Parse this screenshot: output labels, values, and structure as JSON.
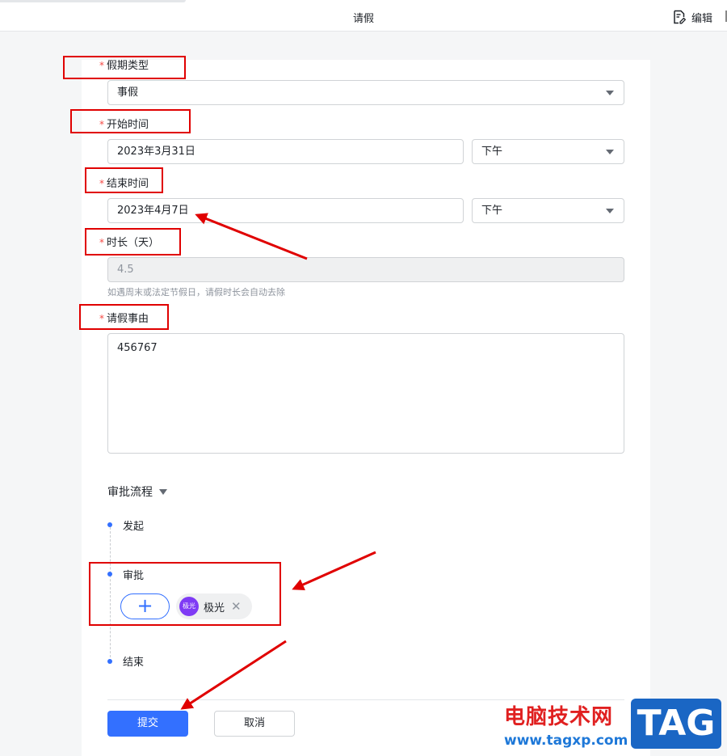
{
  "header": {
    "title": "请假",
    "edit_label": "编辑"
  },
  "form": {
    "leave_type": {
      "label": "假期类型",
      "value": "事假"
    },
    "start_time": {
      "label": "开始时间",
      "date": "2023年3月31日",
      "period": "下午"
    },
    "end_time": {
      "label": "结束时间",
      "date": "2023年4月7日",
      "period": "下午"
    },
    "duration": {
      "label": "时长（天）",
      "value": "4.5",
      "hint": "如遇周末或法定节假日，请假时长会自动去除"
    },
    "reason": {
      "label": "请假事由",
      "value": "456767"
    },
    "required_mark": "*"
  },
  "approval": {
    "title": "审批流程",
    "steps": [
      {
        "label": "发起"
      },
      {
        "label": "审批"
      },
      {
        "label": "结束"
      }
    ],
    "add_symbol": "+",
    "approver": {
      "name": "极光",
      "avatar_text": "极光",
      "remove_symbol": "✕"
    }
  },
  "actions": {
    "submit_label": "提交",
    "cancel_label": "取消"
  },
  "watermark": {
    "site_name": "电脑技术网",
    "url": "www.tagxp.com",
    "tag": "TAG"
  },
  "colors": {
    "accent": "#3370ff",
    "required": "#f54a45",
    "annotation": "#e00000",
    "avatar": "#7f3bf5"
  }
}
